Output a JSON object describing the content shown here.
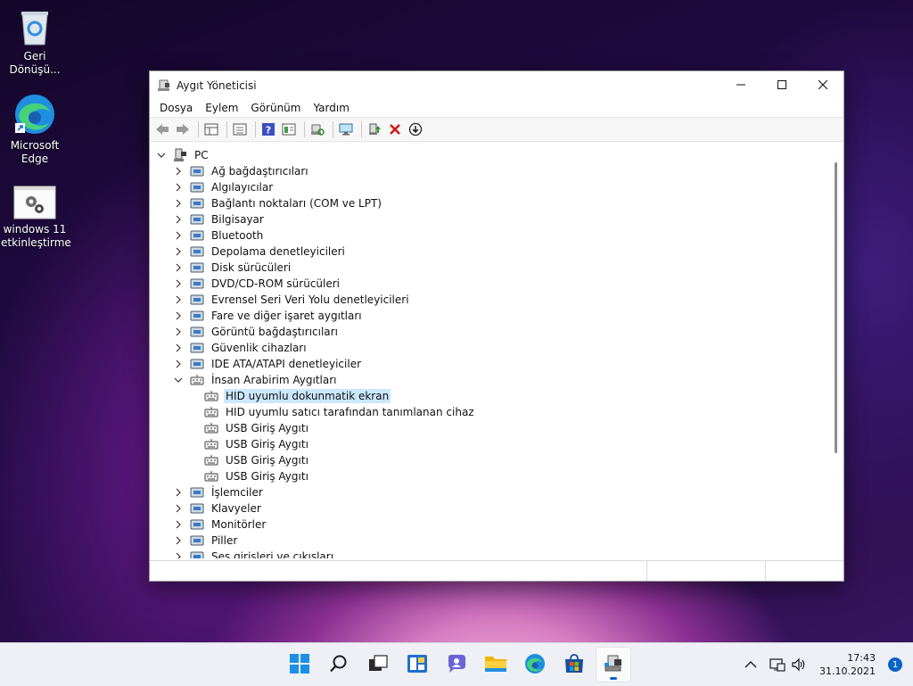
{
  "desktop": {
    "icons": [
      {
        "label": "Geri Dönüşü...",
        "icon": "recycle-bin-icon"
      },
      {
        "label": "Microsoft Edge",
        "icon": "edge-icon"
      },
      {
        "label": "windows 11 etkinleştirme",
        "icon": "settings-shortcut-icon"
      }
    ]
  },
  "window": {
    "title": "Aygıt Yöneticisi",
    "menu": [
      "Dosya",
      "Eylem",
      "Görünüm",
      "Yardım"
    ],
    "toolbar": [
      "back-arrow-icon",
      "forward-arrow-icon",
      "properties-grid-icon",
      "console-tree-icon",
      "help-icon",
      "details-view-icon",
      "scan-hardware-icon",
      "monitor-icon",
      "update-driver-icon",
      "uninstall-x-icon",
      "disable-download-icon"
    ],
    "tree": {
      "root": "PC",
      "items": [
        {
          "label": "Ağ bağdaştırıcıları",
          "expanded": false,
          "icon": "network-adapter-icon"
        },
        {
          "label": "Algılayıcılar",
          "expanded": false,
          "icon": "sensor-icon"
        },
        {
          "label": "Bağlantı noktaları (COM ve LPT)",
          "expanded": false,
          "icon": "port-icon"
        },
        {
          "label": "Bilgisayar",
          "expanded": false,
          "icon": "computer-icon"
        },
        {
          "label": "Bluetooth",
          "expanded": false,
          "icon": "bluetooth-icon"
        },
        {
          "label": "Depolama denetleyicileri",
          "expanded": false,
          "icon": "storage-controller-icon"
        },
        {
          "label": "Disk sürücüleri",
          "expanded": false,
          "icon": "disk-drive-icon"
        },
        {
          "label": "DVD/CD-ROM sürücüleri",
          "expanded": false,
          "icon": "dvd-icon"
        },
        {
          "label": "Evrensel Seri Veri Yolu denetleyicileri",
          "expanded": false,
          "icon": "usb-icon"
        },
        {
          "label": "Fare ve diğer işaret aygıtları",
          "expanded": false,
          "icon": "mouse-icon"
        },
        {
          "label": "Görüntü bağdaştırıcıları",
          "expanded": false,
          "icon": "display-adapter-icon"
        },
        {
          "label": "Güvenlik cihazları",
          "expanded": false,
          "icon": "security-device-icon"
        },
        {
          "label": "IDE ATA/ATAPI denetleyiciler",
          "expanded": false,
          "icon": "ide-icon"
        },
        {
          "label": "İnsan Arabirim Aygıtları",
          "expanded": true,
          "icon": "hid-icon",
          "children": [
            {
              "label": "HID uyumlu dokunmatik ekran",
              "selected": true
            },
            {
              "label": "HID uyumlu satıcı tarafından tanımlanan cihaz"
            },
            {
              "label": "USB Giriş Aygıtı"
            },
            {
              "label": "USB Giriş Aygıtı"
            },
            {
              "label": "USB Giriş Aygıtı"
            },
            {
              "label": "USB Giriş Aygıtı"
            }
          ]
        },
        {
          "label": "İşlemciler",
          "expanded": false,
          "icon": "processor-icon"
        },
        {
          "label": "Klavyeler",
          "expanded": false,
          "icon": "keyboard-icon"
        },
        {
          "label": "Monitörler",
          "expanded": false,
          "icon": "monitor-icon"
        },
        {
          "label": "Piller",
          "expanded": false,
          "icon": "battery-icon"
        },
        {
          "label": "Ses girişleri ve çıkışları",
          "expanded": false,
          "icon": "audio-icon"
        }
      ]
    }
  },
  "taskbar": {
    "apps": [
      "start-icon",
      "search-icon",
      "task-view-icon",
      "widgets-icon",
      "chat-icon",
      "file-explorer-icon",
      "edge-icon",
      "store-icon",
      "device-manager-icon"
    ],
    "clock": {
      "time": "17:43",
      "date": "31.10.2021"
    },
    "notifications": "1",
    "accent": "#0a64c8"
  },
  "colors": {
    "selection": "#cce8ff"
  }
}
